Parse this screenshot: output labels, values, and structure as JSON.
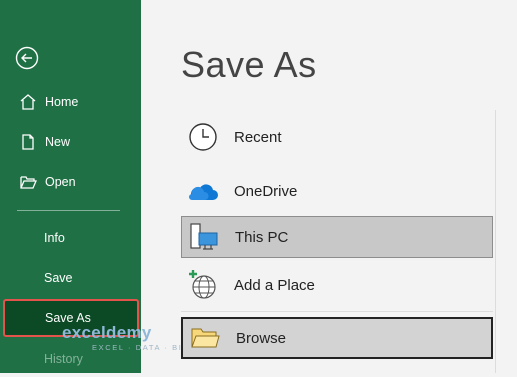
{
  "sidebar": {
    "items": [
      {
        "label": "Home"
      },
      {
        "label": "New"
      },
      {
        "label": "Open"
      }
    ],
    "plain_items": [
      {
        "label": "Info"
      },
      {
        "label": "Save"
      }
    ],
    "selected": {
      "label": "Save As"
    },
    "faded": {
      "label": "History"
    },
    "colors": {
      "background": "#1f7145",
      "selected_background": "#0b4a24",
      "highlight_border": "#e4544d"
    }
  },
  "main": {
    "title": "Save As",
    "options": [
      {
        "label": "Recent",
        "icon": "clock-icon"
      },
      {
        "label": "OneDrive",
        "icon": "cloud-icon"
      },
      {
        "label": "This PC",
        "icon": "computer-icon"
      },
      {
        "label": "Add a Place",
        "icon": "globe-add-icon"
      },
      {
        "label": "Browse",
        "icon": "folder-icon"
      }
    ]
  },
  "watermark": {
    "name": "exceldemy",
    "tagline": "EXCEL · DATA · BI"
  }
}
